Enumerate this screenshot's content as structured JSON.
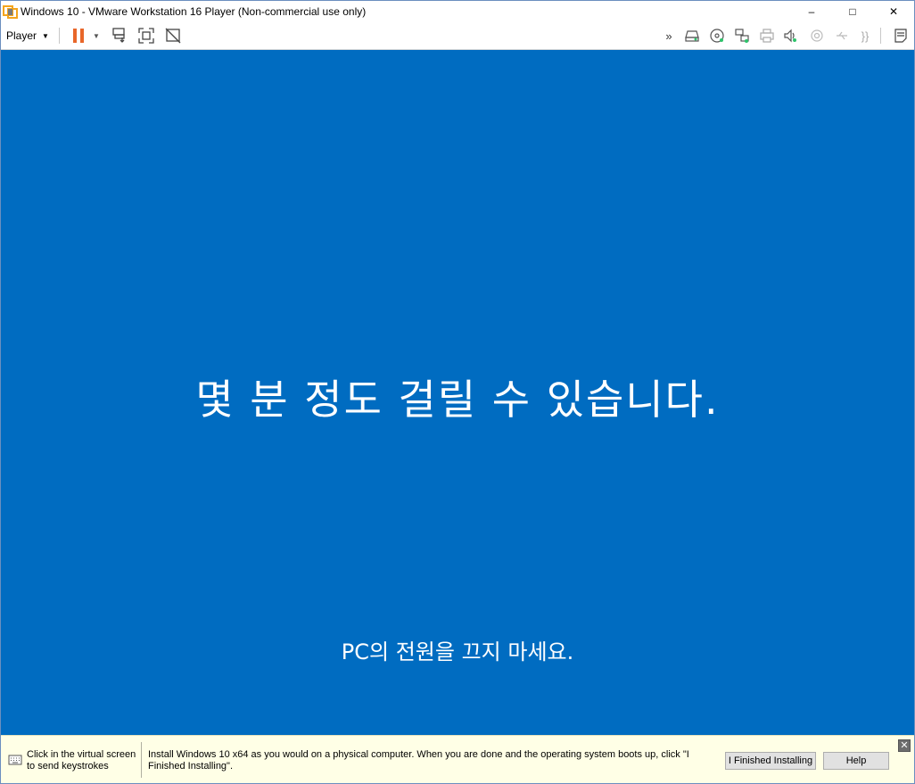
{
  "window": {
    "title": "Windows 10 - VMware Workstation 16 Player (Non-commercial use only)",
    "controls": {
      "minimize": "–",
      "maximize": "□",
      "close": "✕"
    }
  },
  "toolbar": {
    "player_menu": "Player",
    "left_icons": [
      "pause-icon",
      "send-ctrl-alt-del-icon",
      "full-screen-icon",
      "unity-icon"
    ],
    "right_icons": [
      "more-devices-icon",
      "hard-disk-icon",
      "cd-dvd-icon",
      "network-adapter-icon",
      "printer-icon",
      "sound-card-icon",
      "camera-icon",
      "usb-icon",
      "serial-icon",
      "message-log-icon"
    ],
    "accent_pause": "#e8672a"
  },
  "vm": {
    "background": "#006cc1",
    "main_text": "몇 분 정도 걸릴 수 있습니다.",
    "sub_text": "PC의 전원을 끄지 마세요."
  },
  "hint": {
    "left_text": "Click in the virtual screen to send keystrokes",
    "main_text": "Install Windows 10 x64 as you would on a physical computer. When you are done and the operating system boots up, click \"I Finished Installing\".",
    "finished_button": "I Finished Installing",
    "help_button": "Help",
    "close": "✕"
  }
}
